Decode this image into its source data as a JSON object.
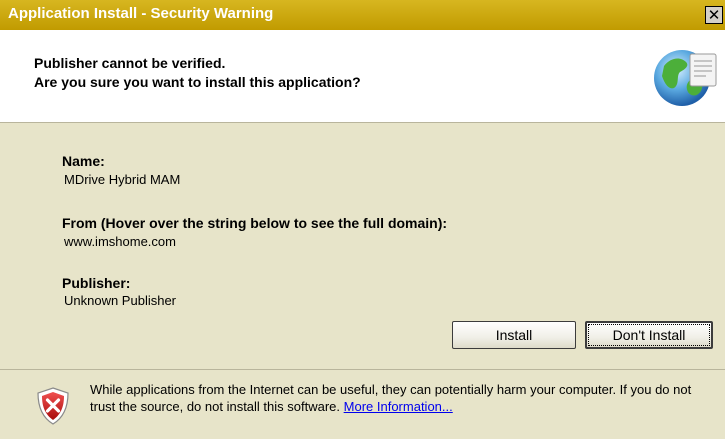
{
  "window": {
    "title": "Application Install - Security Warning",
    "close_glyph": "✕"
  },
  "header": {
    "line1": "Publisher cannot be verified.",
    "line2": "Are you sure you want to install this application?",
    "icon": "globe-icon"
  },
  "fields": {
    "name_label": "Name:",
    "name_value": "MDrive Hybrid MAM",
    "from_label": "From (Hover over the string below to see the full domain):",
    "from_value": "www.imshome.com",
    "publisher_label": "Publisher:",
    "publisher_value": "Unknown Publisher"
  },
  "buttons": {
    "install": "Install",
    "dont_install": "Don't Install"
  },
  "footer": {
    "icon": "shield-warning-icon",
    "warning_text": "While applications from the Internet can be useful, they can potentially harm your computer. If you do not trust the source, do not install this software.",
    "link_text": "More Information..."
  },
  "colors": {
    "titlebar": "#c7a200",
    "body_bg": "#e7e4c9",
    "link": "#0000ee"
  }
}
